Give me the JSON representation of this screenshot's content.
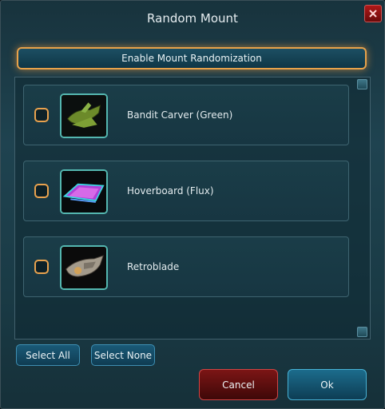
{
  "window": {
    "title": "Random Mount"
  },
  "enable_button": {
    "label": "Enable Mount Randomization"
  },
  "mounts": [
    {
      "name": "Bandit Carver (Green)",
      "icon": "bandit-carver-icon",
      "checked": false
    },
    {
      "name": "Hoverboard (Flux)",
      "icon": "hoverboard-icon",
      "checked": false
    },
    {
      "name": "Retroblade",
      "icon": "retroblade-icon",
      "checked": false
    }
  ],
  "buttons": {
    "select_all": "Select All",
    "select_none": "Select None",
    "cancel": "Cancel",
    "ok": "Ok"
  },
  "colors": {
    "accent": "#e8a24a",
    "frame": "#54b7b0",
    "cancel": "#7c1515",
    "ok": "#1c6c8c"
  }
}
